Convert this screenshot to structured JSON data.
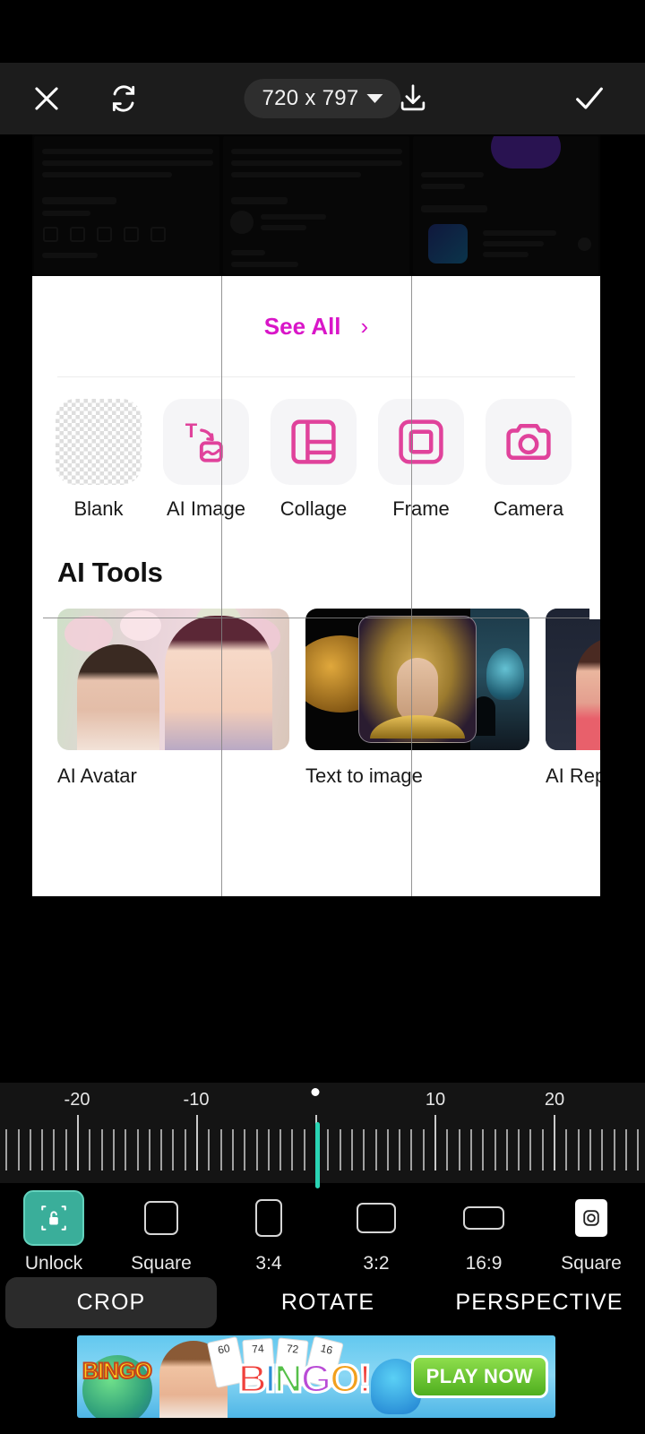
{
  "toolbar": {
    "close_icon": "close-icon",
    "reset_icon": "reset-rotate-icon",
    "size_value": "720 x 797",
    "dropdown_icon": "chevron-down-icon",
    "download_icon": "download-icon",
    "confirm_icon": "checkmark-icon"
  },
  "image_content": {
    "see_all_label": "See All",
    "see_all_chevron": "›",
    "tools": [
      {
        "label": "Blank",
        "icon": "blank-canvas-icon"
      },
      {
        "label": "AI Image",
        "icon": "ai-image-icon"
      },
      {
        "label": "Collage",
        "icon": "collage-icon"
      },
      {
        "label": "Frame",
        "icon": "frame-icon"
      },
      {
        "label": "Camera",
        "icon": "camera-icon"
      }
    ],
    "ai_tools_heading": "AI Tools",
    "ai_tools": [
      {
        "label": "AI Avatar"
      },
      {
        "label": "Text to image"
      },
      {
        "label": "AI Replace"
      }
    ]
  },
  "rotation_ruler": {
    "labels": [
      "-20",
      "-10",
      "10",
      "20"
    ],
    "value": 0,
    "min": -25,
    "max": 25,
    "accent_color": "#2ad4b4"
  },
  "aspect_ratios": [
    {
      "label": "Unlock",
      "icon": "unlock-padlock-icon",
      "selected": true
    },
    {
      "label": "Square",
      "icon": "square-ratio-icon",
      "selected": false
    },
    {
      "label": "3:4",
      "icon": "portrait-ratio-icon",
      "selected": false
    },
    {
      "label": "3:2",
      "icon": "landscape-ratio-icon",
      "selected": false
    },
    {
      "label": "16:9",
      "icon": "widescreen-ratio-icon",
      "selected": false
    },
    {
      "label": "Square",
      "icon": "instagram-square-icon",
      "selected": false
    }
  ],
  "tabs": [
    {
      "label": "CROP",
      "active": true
    },
    {
      "label": "ROTATE",
      "active": false
    },
    {
      "label": "PERSPECTIVE",
      "active": false
    }
  ],
  "ad": {
    "brand_small": "BINGO",
    "title_letters": [
      "B",
      "I",
      "N",
      "G",
      "O",
      "!"
    ],
    "cta_label": "PLAY NOW",
    "card_numbers": [
      "60",
      "74",
      "72",
      "16"
    ]
  }
}
